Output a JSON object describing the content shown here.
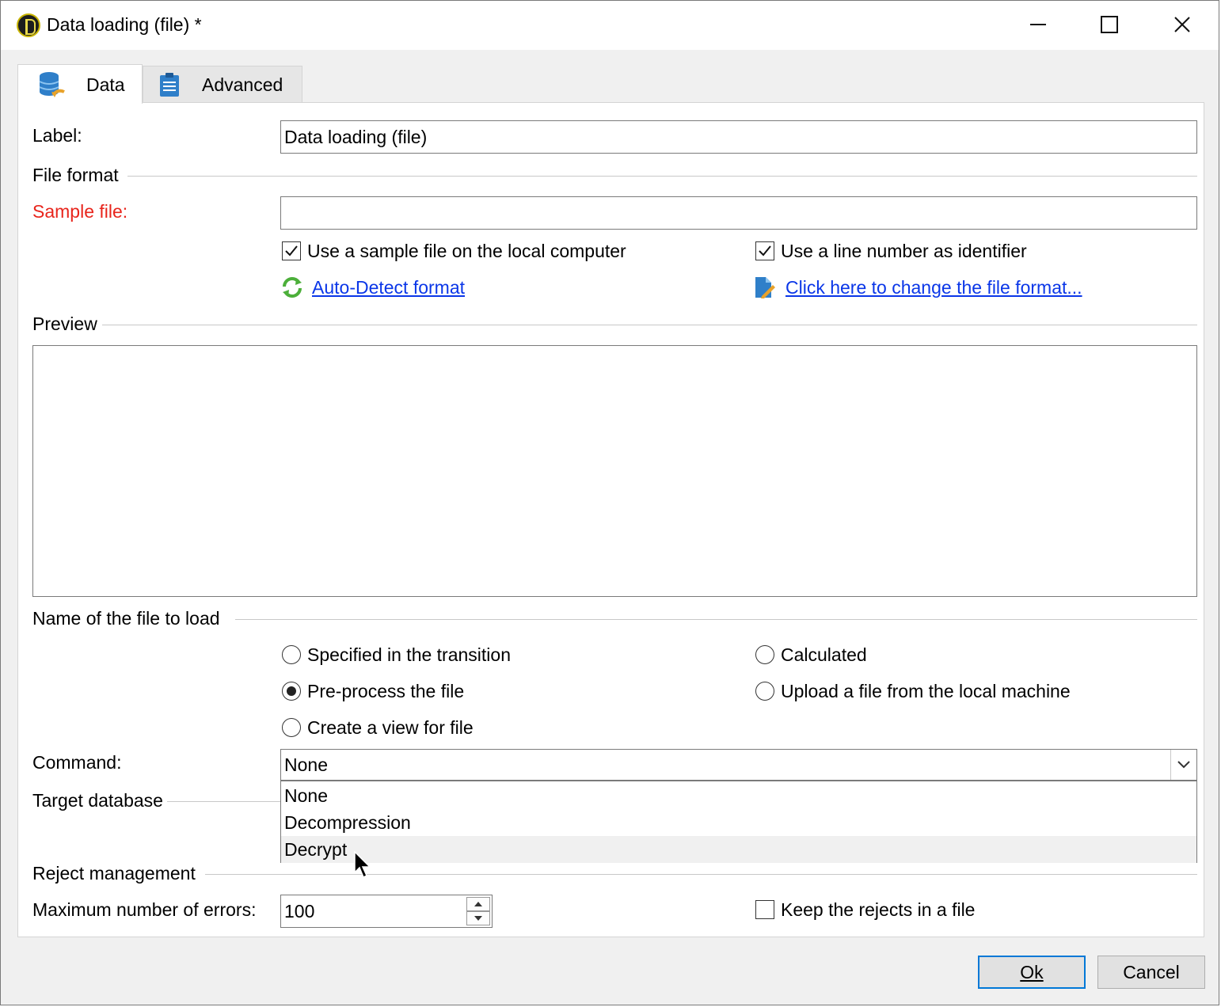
{
  "window": {
    "title": "Data loading (file) *"
  },
  "tabs": [
    {
      "label": "Data",
      "icon": "database-icon",
      "active": true
    },
    {
      "label": "Advanced",
      "icon": "clipboard-icon",
      "active": false
    }
  ],
  "form": {
    "label_caption": "Label:",
    "label_value": "Data loading (file)",
    "file_format_section": "File format",
    "sample_file_caption": "Sample file:",
    "sample_file_value": "",
    "use_sample_local": {
      "label": "Use a sample file on the local computer",
      "checked": true
    },
    "use_line_number": {
      "label": "Use a line number as identifier",
      "checked": true
    },
    "auto_detect_link": "Auto-Detect format",
    "change_format_link": "Click here to change the file format...",
    "preview_section": "Preview",
    "file_to_load_section": "Name of the file to load",
    "radios": {
      "specified": "Specified in the transition",
      "calculated": "Calculated",
      "preprocess": "Pre-process the file",
      "upload": "Upload a file from the local machine",
      "create_view": "Create a view for file"
    },
    "selected_radio": "preprocess",
    "command_caption": "Command:",
    "command_value": "None",
    "command_options": [
      "None",
      "Decompression",
      "Decrypt"
    ],
    "command_highlighted": "Decrypt",
    "target_db_section": "Target database",
    "reject_section": "Reject management",
    "max_errors_caption": "Maximum number of errors:",
    "max_errors_value": "100",
    "keep_rejects": {
      "label": "Keep the rejects in a file",
      "checked": false
    }
  },
  "footer": {
    "ok_label": "Ok",
    "cancel_label": "Cancel"
  },
  "colors": {
    "required_label": "#e8251c",
    "link": "#0a36e8",
    "default_button_border": "#0078d7"
  }
}
